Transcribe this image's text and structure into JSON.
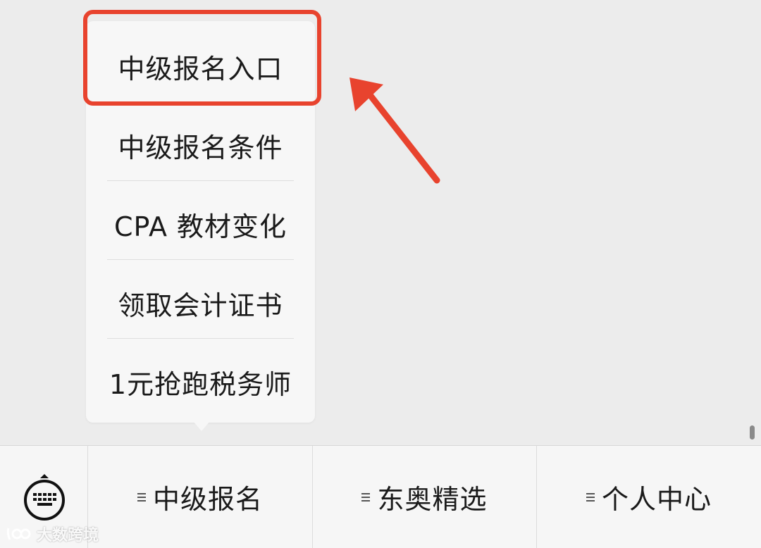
{
  "popup_menu": {
    "items": [
      {
        "label": "中级报名入口"
      },
      {
        "label": "中级报名条件"
      },
      {
        "label": "CPA 教材变化"
      },
      {
        "label": "领取会计证书"
      },
      {
        "label": "1元抢跑税务师"
      }
    ]
  },
  "bottom_menu": {
    "keyboard_icon": "keyboard-icon",
    "tabs": [
      {
        "label": "中级报名",
        "icon": "menu-lines-icon"
      },
      {
        "label": "东奥精选",
        "icon": "menu-lines-icon"
      },
      {
        "label": "个人中心",
        "icon": "menu-lines-icon"
      }
    ]
  },
  "watermark": {
    "text": "大数跨境"
  },
  "colors": {
    "highlight": "#e8432e",
    "background": "#ececec",
    "popup": "#f7f7f7"
  }
}
